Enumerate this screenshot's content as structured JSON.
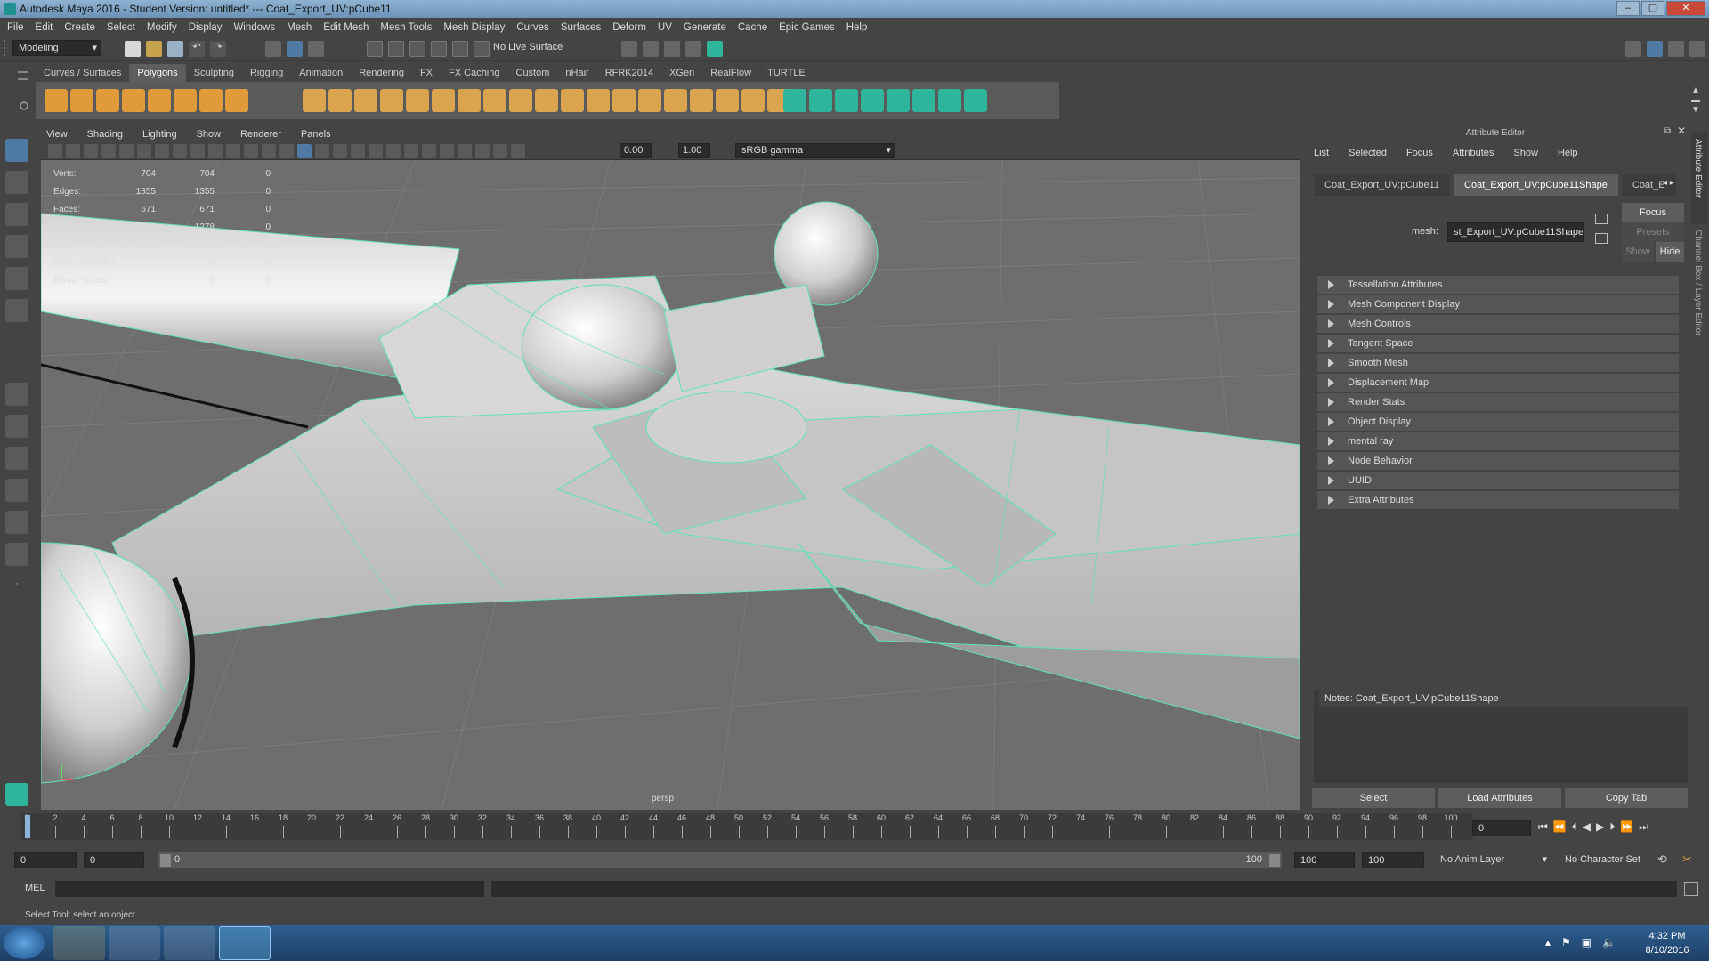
{
  "window": {
    "title": "Autodesk Maya 2016 - Student Version: untitled*   ---   Coat_Export_UV:pCube11",
    "minimize": "‒",
    "maximize": "▢",
    "close": "✕"
  },
  "menubar": [
    "File",
    "Edit",
    "Create",
    "Select",
    "Modify",
    "Display",
    "Windows",
    "Mesh",
    "Edit Mesh",
    "Mesh Tools",
    "Mesh Display",
    "Curves",
    "Surfaces",
    "Deform",
    "UV",
    "Generate",
    "Cache",
    "Epic Games",
    "Help"
  ],
  "statusline": {
    "mode": "Modeling",
    "live_surface": "No Live Surface"
  },
  "shelf_tabs": [
    "Curves / Surfaces",
    "Polygons",
    "Sculpting",
    "Rigging",
    "Animation",
    "Rendering",
    "FX",
    "FX Caching",
    "Custom",
    "nHair",
    "RFRK2014",
    "XGen",
    "RealFlow",
    "TURTLE"
  ],
  "shelf_active": "Polygons",
  "viewport": {
    "menu": [
      "View",
      "Shading",
      "Lighting",
      "Show",
      "Renderer",
      "Panels"
    ],
    "exposure": "0.00",
    "gamma": "1.00",
    "color_space": "sRGB gamma",
    "camera_label": "persp",
    "hud": [
      {
        "label": "Verts:",
        "a": "704",
        "b": "704",
        "c": "0"
      },
      {
        "label": "Edges:",
        "a": "1355",
        "b": "1355",
        "c": "0"
      },
      {
        "label": "Faces:",
        "a": "671",
        "b": "671",
        "c": "0"
      },
      {
        "label": "Tris:",
        "a": "1278",
        "b": "1278",
        "c": "0"
      },
      {
        "label": "UVs:",
        "a": "1043",
        "b": "1043",
        "c": "0"
      },
      {
        "label": "Bifrost Particles:",
        "a": "",
        "b": "0",
        "c": "0"
      },
      {
        "label": "Bifrost Voxels:",
        "a": "",
        "b": "0",
        "c": "0"
      }
    ]
  },
  "attribute_editor": {
    "title": "Attribute Editor",
    "menu": [
      "List",
      "Selected",
      "Focus",
      "Attributes",
      "Show",
      "Help"
    ],
    "tabs": [
      "Coat_Export_UV:pCube11",
      "Coat_Export_UV:pCube11Shape",
      "Coat_E"
    ],
    "active_tab": "Coat_Export_UV:pCube11Shape",
    "mesh_label": "mesh:",
    "mesh_value": "st_Export_UV:pCube11Shape",
    "focus": "Focus",
    "presets": "Presets",
    "show": "Show",
    "hide": "Hide",
    "sections": [
      "Tessellation Attributes",
      "Mesh Component Display",
      "Mesh Controls",
      "Tangent Space",
      "Smooth Mesh",
      "Displacement Map",
      "Render Stats",
      "Object Display",
      "mental ray",
      "Node Behavior",
      "UUID",
      "Extra Attributes"
    ],
    "notes": "Notes:  Coat_Export_UV:pCube11Shape",
    "buttons": [
      "Select",
      "Load Attributes",
      "Copy Tab"
    ],
    "side_tabs": [
      "Attribute Editor",
      "Channel Box / Layer Editor"
    ]
  },
  "timeline": {
    "ticks": [
      "0",
      "2",
      "4",
      "6",
      "8",
      "10",
      "12",
      "14",
      "16",
      "18",
      "20",
      "22",
      "24",
      "26",
      "28",
      "30",
      "32",
      "34",
      "36",
      "38",
      "40",
      "42",
      "44",
      "46",
      "48",
      "50",
      "52",
      "54",
      "56",
      "58",
      "60",
      "62",
      "64",
      "66",
      "68",
      "70",
      "72",
      "74",
      "76",
      "78",
      "80",
      "82",
      "84",
      "86",
      "88",
      "90",
      "92",
      "94",
      "96",
      "98",
      "100"
    ],
    "current_frame": "0"
  },
  "range": {
    "start": "0",
    "start_inner": "0",
    "slider_start": "0",
    "slider_end": "100",
    "end_inner": "100",
    "end": "100",
    "anim_layer": "No Anim Layer",
    "character_set": "No Character Set"
  },
  "cmdline": {
    "label": "MEL"
  },
  "helpline": "Select Tool: select an object",
  "taskbar": {
    "time": "4:32 PM",
    "date": "8/10/2016"
  },
  "colors": {
    "wire": "#5fe3b0",
    "bg": "#444444",
    "viewport": "#6e6e6e"
  }
}
